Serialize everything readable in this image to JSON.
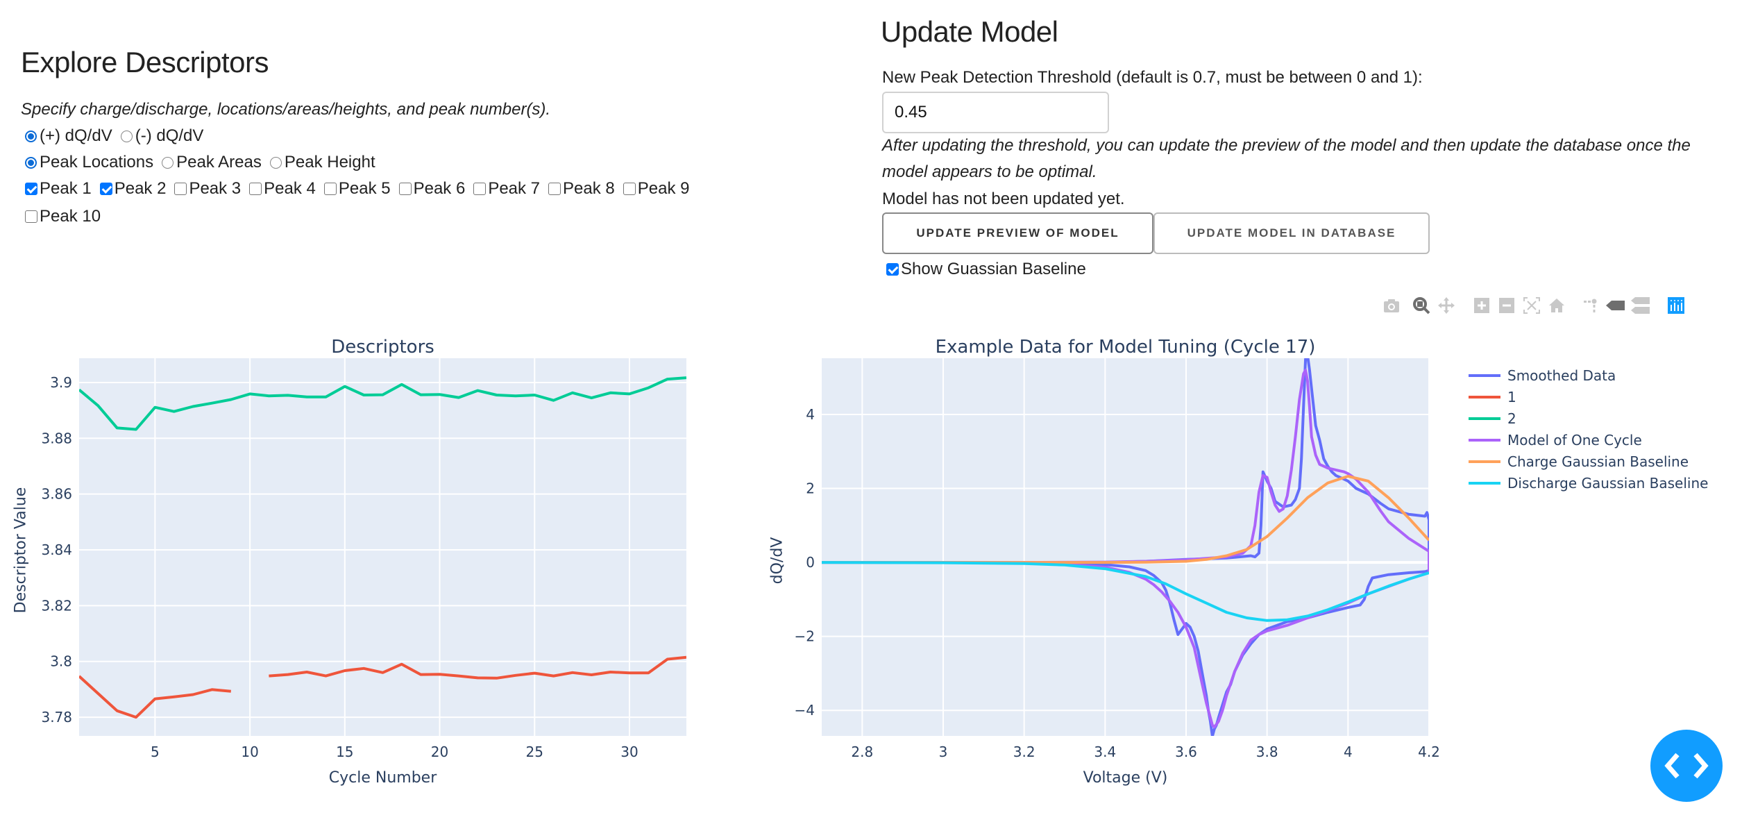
{
  "explore": {
    "title": "Explore Descriptors",
    "instructions": "Specify charge/discharge, locations/areas/heights, and peak number(s).",
    "direction_options": [
      {
        "label": "(+) dQ/dV",
        "selected": true
      },
      {
        "label": "(-) dQ/dV",
        "selected": false
      }
    ],
    "descriptor_options": [
      {
        "label": "Peak Locations",
        "selected": true
      },
      {
        "label": "Peak Areas",
        "selected": false
      },
      {
        "label": "Peak Height",
        "selected": false
      }
    ],
    "peaks": [
      {
        "label": "Peak 1",
        "checked": true
      },
      {
        "label": "Peak 2",
        "checked": true
      },
      {
        "label": "Peak 3",
        "checked": false
      },
      {
        "label": "Peak 4",
        "checked": false
      },
      {
        "label": "Peak 5",
        "checked": false
      },
      {
        "label": "Peak 6",
        "checked": false
      },
      {
        "label": "Peak 7",
        "checked": false
      },
      {
        "label": "Peak 8",
        "checked": false
      },
      {
        "label": "Peak 9",
        "checked": false
      },
      {
        "label": "Peak 10",
        "checked": false
      }
    ]
  },
  "update": {
    "title": "Update Model",
    "threshold_label": "New Peak Detection Threshold (default is 0.7, must be between 0 and 1):",
    "threshold_value": "0.45",
    "help_text": "After updating the threshold, you can update the preview of the model and then update the database once the model appears to be optimal.",
    "status": "Model has not been updated yet.",
    "preview_button": "UPDATE PREVIEW OF MODEL",
    "database_button": "UPDATE MODEL IN DATABASE",
    "show_baseline_label": "Show Guassian Baseline",
    "show_baseline_checked": true
  },
  "modebar": {
    "buttons": [
      "camera-icon",
      "zoom-icon",
      "pan-icon",
      "zoom-in-icon",
      "zoom-out-icon",
      "autoscale-icon",
      "reset-axes-icon",
      "spike-lines-icon",
      "hover-closest-icon",
      "hover-compare-icon",
      "plotly-logo-icon"
    ],
    "active": "zoom-icon"
  },
  "fab": {
    "icon": "code-icon",
    "color": "#119dff"
  },
  "chart_data": [
    {
      "type": "line",
      "title": "Descriptors",
      "xlabel": "Cycle Number",
      "ylabel": "Descriptor Value",
      "xlim": [
        1,
        33
      ],
      "ylim": [
        3.7733,
        3.9087
      ],
      "xticks": [
        5,
        10,
        15,
        20,
        25,
        30
      ],
      "yticks": [
        3.78,
        3.8,
        3.82,
        3.84,
        3.86,
        3.88,
        3.9
      ],
      "ytick_labels": [
        "3.78",
        "3.8",
        "3.82",
        "3.84",
        "3.86",
        "3.88",
        "3.9"
      ],
      "grid": true,
      "x": [
        1,
        2,
        3,
        4,
        5,
        6,
        7,
        8,
        9,
        10,
        11,
        12,
        13,
        14,
        15,
        16,
        17,
        18,
        19,
        20,
        21,
        22,
        23,
        24,
        25,
        26,
        27,
        28,
        29,
        30,
        31,
        32,
        33
      ],
      "series": [
        {
          "name": "1",
          "color": "#ef553b",
          "values": [
            3.7947,
            3.7885,
            3.7823,
            3.78,
            3.7866,
            3.7873,
            3.7881,
            3.7899,
            3.7893,
            null,
            3.7948,
            3.7953,
            3.7962,
            3.7948,
            3.7967,
            3.7975,
            3.796,
            3.799,
            3.7953,
            3.7954,
            3.7948,
            3.7941,
            3.794,
            3.795,
            3.7958,
            3.7948,
            3.796,
            3.7952,
            3.7962,
            3.7959,
            3.7959,
            3.8008,
            3.8015
          ]
        },
        {
          "name": "2",
          "color": "#00cc96",
          "values": [
            3.8974,
            3.8917,
            3.8837,
            3.8832,
            3.8911,
            3.8896,
            3.8914,
            3.8926,
            3.8939,
            3.8959,
            3.8952,
            3.8954,
            3.8948,
            3.8948,
            3.8986,
            3.8955,
            3.8956,
            3.8993,
            3.8956,
            3.8957,
            3.8946,
            3.8971,
            3.8955,
            3.8952,
            3.8955,
            3.8936,
            3.8963,
            3.8945,
            3.8963,
            3.8959,
            3.8981,
            3.9012,
            3.9017
          ]
        }
      ]
    },
    {
      "type": "line",
      "title": "Example Data for Model Tuning (Cycle 17)",
      "xlabel": "Voltage (V)",
      "ylabel": "dQ/dV",
      "xlim": [
        2.7,
        4.2
      ],
      "ylim": [
        -4.69,
        5.52
      ],
      "xticks": [
        2.8,
        3.0,
        3.2,
        3.4,
        3.6,
        3.8,
        4.0,
        4.2
      ],
      "xtick_labels": [
        "2.8",
        "3",
        "3.2",
        "3.4",
        "3.6",
        "3.8",
        "4",
        "4.2"
      ],
      "yticks": [
        -4,
        -2,
        0,
        2,
        4
      ],
      "ytick_labels": [
        "−4",
        "−2",
        "0",
        "2",
        "4"
      ],
      "grid": true,
      "legend": {
        "position": "right",
        "entries": [
          "Smoothed Data",
          "1",
          "2",
          "Model of One Cycle",
          "Charge Gaussian Baseline",
          "Discharge Gaussian Baseline"
        ]
      },
      "series": [
        {
          "name": "Smoothed Data",
          "color": "#636efa",
          "x": [
            2.7,
            3.0,
            3.2,
            3.4,
            3.5,
            3.6,
            3.7,
            3.72,
            3.74,
            3.76,
            3.77,
            3.78,
            3.785,
            3.79,
            3.8,
            3.81,
            3.82,
            3.84,
            3.86,
            3.87,
            3.88,
            3.885,
            3.89,
            3.895,
            3.9,
            3.905,
            3.91,
            3.92,
            3.93,
            3.94,
            3.95,
            3.96,
            3.97,
            3.98,
            3.99,
            4.0,
            4.02,
            4.05,
            4.08,
            4.1,
            4.15,
            4.19,
            4.195,
            4.2,
            4.2,
            4.19,
            4.15,
            4.1,
            4.06,
            4.05,
            4.04,
            4.03,
            4.0,
            3.95,
            3.9,
            3.85,
            3.8,
            3.78,
            3.76,
            3.74,
            3.72,
            3.71,
            3.7,
            3.69,
            3.68,
            3.675,
            3.67,
            3.665,
            3.66,
            3.655,
            3.65,
            3.64,
            3.63,
            3.62,
            3.61,
            3.6,
            3.59,
            3.58,
            3.57,
            3.56,
            3.55,
            3.54,
            3.52,
            3.5,
            3.46,
            3.4,
            3.3,
            3.2,
            3.0,
            2.7
          ],
          "y": [
            0,
            0,
            0,
            0,
            0.03,
            0.08,
            0.12,
            0.14,
            0.16,
            0.18,
            0.15,
            0.25,
            1.0,
            2.45,
            2.2,
            2.0,
            1.65,
            1.5,
            1.55,
            1.7,
            2.0,
            2.8,
            4.2,
            5.5,
            5.6,
            5.2,
            4.7,
            3.7,
            3.3,
            2.8,
            2.6,
            2.45,
            2.35,
            2.3,
            2.25,
            2.2,
            2.0,
            1.85,
            1.6,
            1.45,
            1.3,
            1.25,
            1.35,
            1.15,
            -0.22,
            -0.25,
            -0.28,
            -0.33,
            -0.42,
            -0.65,
            -1.0,
            -1.15,
            -1.22,
            -1.35,
            -1.5,
            -1.6,
            -1.8,
            -1.95,
            -2.2,
            -2.5,
            -2.95,
            -3.3,
            -3.5,
            -3.85,
            -4.2,
            -4.4,
            -4.5,
            -4.7,
            -4.3,
            -4.0,
            -3.6,
            -3.0,
            -2.4,
            -2.0,
            -1.75,
            -1.65,
            -1.8,
            -1.95,
            -1.55,
            -1.1,
            -0.75,
            -0.55,
            -0.35,
            -0.22,
            -0.12,
            -0.06,
            -0.03,
            -0.01,
            0,
            0
          ]
        },
        {
          "name": "Model of One Cycle",
          "color": "#ab63fa",
          "x": [
            2.7,
            3.0,
            3.2,
            3.4,
            3.5,
            3.6,
            3.7,
            3.74,
            3.76,
            3.77,
            3.78,
            3.79,
            3.8,
            3.81,
            3.82,
            3.83,
            3.84,
            3.85,
            3.86,
            3.87,
            3.88,
            3.89,
            3.895,
            3.9,
            3.905,
            3.91,
            3.92,
            3.93,
            3.95,
            3.97,
            3.99,
            4.0,
            4.02,
            4.05,
            4.08,
            4.1,
            4.15,
            4.2,
            4.2,
            4.15,
            4.1,
            4.05,
            4.0,
            3.95,
            3.9,
            3.85,
            3.8,
            3.78,
            3.76,
            3.74,
            3.72,
            3.7,
            3.69,
            3.68,
            3.67,
            3.665,
            3.66,
            3.65,
            3.64,
            3.63,
            3.62,
            3.6,
            3.58,
            3.56,
            3.54,
            3.52,
            3.5,
            3.46,
            3.4,
            3.3,
            3.2,
            3.0,
            2.7
          ],
          "y": [
            0,
            0,
            0,
            0.01,
            0.03,
            0.07,
            0.15,
            0.25,
            0.45,
            1.0,
            1.9,
            2.35,
            2.3,
            1.9,
            1.55,
            1.38,
            1.45,
            1.8,
            2.5,
            3.4,
            4.4,
            5.1,
            5.2,
            4.9,
            4.2,
            3.4,
            2.9,
            2.65,
            2.55,
            2.5,
            2.45,
            2.4,
            2.25,
            1.9,
            1.4,
            1.1,
            0.65,
            0.3,
            -0.28,
            -0.45,
            -0.65,
            -0.85,
            -1.1,
            -1.3,
            -1.5,
            -1.7,
            -1.85,
            -1.95,
            -2.1,
            -2.45,
            -2.95,
            -3.6,
            -4.0,
            -4.3,
            -4.45,
            -4.4,
            -4.2,
            -3.8,
            -3.3,
            -2.8,
            -2.3,
            -1.75,
            -1.35,
            -1.05,
            -0.8,
            -0.6,
            -0.45,
            -0.27,
            -0.13,
            -0.05,
            -0.02,
            0,
            0
          ]
        },
        {
          "name": "Charge Gaussian Baseline",
          "color": "#ffa15a",
          "x": [
            2.7,
            3.0,
            3.2,
            3.4,
            3.5,
            3.6,
            3.65,
            3.7,
            3.75,
            3.8,
            3.85,
            3.9,
            3.95,
            4.0,
            4.05,
            4.1,
            4.15,
            4.2
          ],
          "y": [
            0,
            0,
            0,
            0,
            0.005,
            0.03,
            0.08,
            0.18,
            0.35,
            0.7,
            1.2,
            1.75,
            2.15,
            2.33,
            2.2,
            1.75,
            1.2,
            0.6
          ]
        },
        {
          "name": "Discharge Gaussian Baseline",
          "color": "#19d3f3",
          "x": [
            2.7,
            3.0,
            3.2,
            3.3,
            3.4,
            3.5,
            3.55,
            3.6,
            3.65,
            3.7,
            3.75,
            3.8,
            3.85,
            3.9,
            3.95,
            4.0,
            4.05,
            4.1,
            4.15,
            4.2
          ],
          "y": [
            0,
            -0.01,
            -0.03,
            -0.07,
            -0.17,
            -0.38,
            -0.58,
            -0.85,
            -1.1,
            -1.35,
            -1.5,
            -1.57,
            -1.55,
            -1.45,
            -1.28,
            -1.07,
            -0.85,
            -0.64,
            -0.45,
            -0.28
          ]
        }
      ]
    }
  ]
}
